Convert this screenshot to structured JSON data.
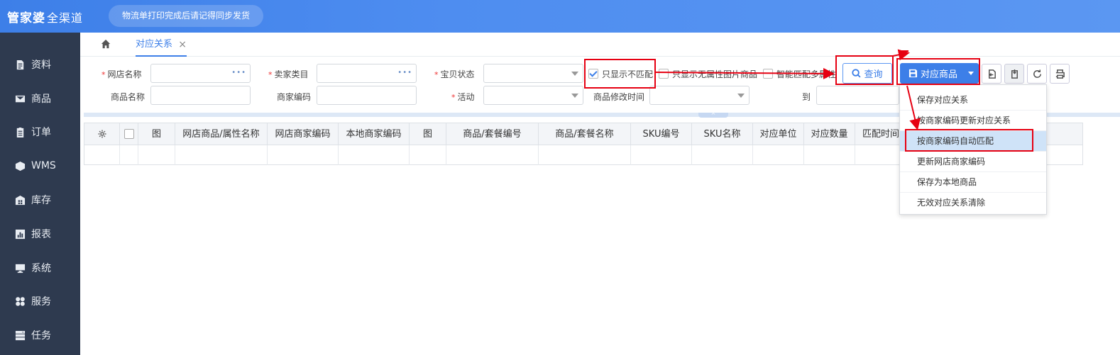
{
  "header": {
    "logo_main": "管家婆",
    "logo_sub": "全渠道",
    "notice": "物流单打印完成后请记得同步发货"
  },
  "sidebar": {
    "items": [
      {
        "label": "资料",
        "icon": "document-icon"
      },
      {
        "label": "商品",
        "icon": "envelope-icon"
      },
      {
        "label": "订单",
        "icon": "clipboard-icon"
      },
      {
        "label": "WMS",
        "icon": "cube-icon"
      },
      {
        "label": "库存",
        "icon": "warehouse-icon"
      },
      {
        "label": "报表",
        "icon": "chart-icon"
      },
      {
        "label": "系统",
        "icon": "monitor-icon"
      },
      {
        "label": "服务",
        "icon": "grid-icon"
      },
      {
        "label": "任务",
        "icon": "server-icon"
      }
    ]
  },
  "tabs": {
    "active": "对应关系",
    "close": "×"
  },
  "filters": {
    "shop_name": "网店名称",
    "seller_category": "卖家类目",
    "item_status": "宝贝状态",
    "product_name": "商品名称",
    "merchant_code": "商家编码",
    "activity": "活动",
    "modify_time": "商品修改时间",
    "to": "到",
    "only_unmatched": "只显示不匹配",
    "only_no_attr_image": "只显示无属性图片商品",
    "smart_match_multi_attr": "智能匹配多属性",
    "dots": "•••"
  },
  "buttons": {
    "query": "查询",
    "match_product": "对应商品"
  },
  "table": {
    "headers": [
      "图",
      "网店商品/属性名称",
      "网店商家编码",
      "本地商家编码",
      "图",
      "商品/套餐编号",
      "商品/套餐名称",
      "SKU编号",
      "SKU名称",
      "对应单位",
      "对应数量",
      "匹配时间"
    ]
  },
  "menu": {
    "items": [
      "保存对应关系",
      "按商家编码更新对应关系",
      "按商家编码自动匹配",
      "更新网店商家编码",
      "保存为本地商品",
      "无效对应关系清除"
    ],
    "highlighted_index": 2
  },
  "colors": {
    "primary": "#3d7fe8",
    "sidebar": "#2e3a4f",
    "annotation": "#e60012"
  }
}
